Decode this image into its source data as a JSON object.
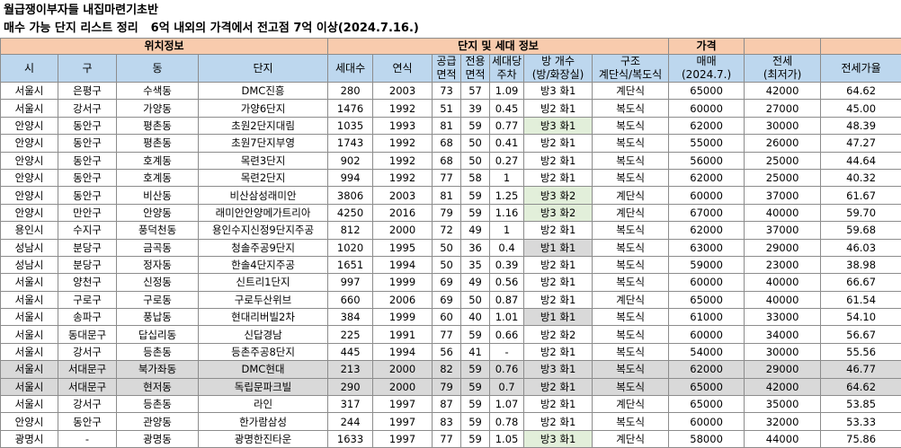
{
  "title_line1": "월급쟁이부자들 내집마련기초반",
  "title_line2_a": "매수 가능 단지 리스트 정리",
  "title_line2_b": "6억 내외의 가격에서 전고점 7억 이상(2024.7.16.)",
  "groups": {
    "location": "위치정보",
    "complex": "단지 및 세대 정보",
    "price": "가격"
  },
  "columns": [
    "시",
    "구",
    "동",
    "단지",
    "세대수",
    "연식",
    "공급\n면적",
    "전용\n면적",
    "세대당\n주차",
    "방 개수\n(방/화장실)",
    "구조\n계단식/복도식",
    "매매\n(2024.7.)",
    "전세\n(최저가)",
    "전세가율"
  ],
  "rows": [
    {
      "si": "서울시",
      "gu": "은평구",
      "dong": "수색동",
      "danji": "DMC진흥",
      "units": "280",
      "year": "2003",
      "supply": "73",
      "exclusive": "57",
      "parking": "1.09",
      "rooms": "방3 화1",
      "structure": "계단식",
      "sale": "65000",
      "jeonse": "42000",
      "ratio": "64.62",
      "room_hl": "",
      "row_hl": ""
    },
    {
      "si": "서울시",
      "gu": "강서구",
      "dong": "가양동",
      "danji": "가양6단지",
      "units": "1476",
      "year": "1992",
      "supply": "51",
      "exclusive": "39",
      "parking": "0.45",
      "rooms": "빙2 화1",
      "structure": "복도식",
      "sale": "60000",
      "jeonse": "27000",
      "ratio": "45.00",
      "room_hl": "",
      "row_hl": ""
    },
    {
      "si": "안양시",
      "gu": "동안구",
      "dong": "평촌동",
      "danji": "초원2단지대림",
      "units": "1035",
      "year": "1993",
      "supply": "81",
      "exclusive": "59",
      "parking": "0.77",
      "rooms": "방3 화1",
      "structure": "복도식",
      "sale": "62000",
      "jeonse": "30000",
      "ratio": "48.39",
      "room_hl": "green",
      "row_hl": ""
    },
    {
      "si": "안양시",
      "gu": "동안구",
      "dong": "평촌동",
      "danji": "초원7단지부영",
      "units": "1743",
      "year": "1992",
      "supply": "68",
      "exclusive": "50",
      "parking": "0.41",
      "rooms": "방2 화1",
      "structure": "복도식",
      "sale": "55000",
      "jeonse": "26000",
      "ratio": "47.27",
      "room_hl": "",
      "row_hl": ""
    },
    {
      "si": "안양시",
      "gu": "동안구",
      "dong": "호계동",
      "danji": "목련3단지",
      "units": "902",
      "year": "1992",
      "supply": "68",
      "exclusive": "50",
      "parking": "0.27",
      "rooms": "방2 화1",
      "structure": "복도식",
      "sale": "56000",
      "jeonse": "25000",
      "ratio": "44.64",
      "room_hl": "",
      "row_hl": ""
    },
    {
      "si": "안양시",
      "gu": "동안구",
      "dong": "호계동",
      "danji": "목련2단지",
      "units": "994",
      "year": "1992",
      "supply": "77",
      "exclusive": "58",
      "parking": "1",
      "rooms": "방2 화1",
      "structure": "복도식",
      "sale": "62000",
      "jeonse": "25000",
      "ratio": "40.32",
      "room_hl": "",
      "row_hl": ""
    },
    {
      "si": "안양시",
      "gu": "동안구",
      "dong": "비산동",
      "danji": "비산삼성래미안",
      "units": "3806",
      "year": "2003",
      "supply": "81",
      "exclusive": "59",
      "parking": "1.25",
      "rooms": "방3 화2",
      "structure": "계단식",
      "sale": "60000",
      "jeonse": "37000",
      "ratio": "61.67",
      "room_hl": "green",
      "row_hl": ""
    },
    {
      "si": "안양시",
      "gu": "만안구",
      "dong": "안양동",
      "danji": "래미안안양메가트리아",
      "units": "4250",
      "year": "2016",
      "supply": "79",
      "exclusive": "59",
      "parking": "1.16",
      "rooms": "방3 화2",
      "structure": "계단식",
      "sale": "67000",
      "jeonse": "40000",
      "ratio": "59.70",
      "room_hl": "green",
      "row_hl": ""
    },
    {
      "si": "용인시",
      "gu": "수지구",
      "dong": "풍덕천동",
      "danji": "용인수지신정9단지주공",
      "units": "812",
      "year": "2000",
      "supply": "72",
      "exclusive": "49",
      "parking": "1",
      "rooms": "방2 화1",
      "structure": "복도식",
      "sale": "62000",
      "jeonse": "37000",
      "ratio": "59.68",
      "room_hl": "",
      "row_hl": ""
    },
    {
      "si": "성남시",
      "gu": "분당구",
      "dong": "금곡동",
      "danji": "청솔주공9단지",
      "units": "1020",
      "year": "1995",
      "supply": "50",
      "exclusive": "36",
      "parking": "0.4",
      "rooms": "방1 화1",
      "structure": "복도식",
      "sale": "63000",
      "jeonse": "29000",
      "ratio": "46.03",
      "room_hl": "gray",
      "row_hl": ""
    },
    {
      "si": "성남시",
      "gu": "분당구",
      "dong": "정자동",
      "danji": "한솔4단지주공",
      "units": "1651",
      "year": "1994",
      "supply": "50",
      "exclusive": "35",
      "parking": "0.39",
      "rooms": "방2 화1",
      "structure": "복도식",
      "sale": "59000",
      "jeonse": "23000",
      "ratio": "38.98",
      "room_hl": "",
      "row_hl": ""
    },
    {
      "si": "서울시",
      "gu": "양천구",
      "dong": "신정동",
      "danji": "신트리1단지",
      "units": "997",
      "year": "1999",
      "supply": "69",
      "exclusive": "49",
      "parking": "0.56",
      "rooms": "방2 화1",
      "structure": "복도식",
      "sale": "60000",
      "jeonse": "40000",
      "ratio": "66.67",
      "room_hl": "",
      "row_hl": ""
    },
    {
      "si": "서울시",
      "gu": "구로구",
      "dong": "구로동",
      "danji": "구로두산위브",
      "units": "660",
      "year": "2006",
      "supply": "69",
      "exclusive": "50",
      "parking": "0.87",
      "rooms": "방2 화1",
      "structure": "계단식",
      "sale": "65000",
      "jeonse": "40000",
      "ratio": "61.54",
      "room_hl": "",
      "row_hl": ""
    },
    {
      "si": "서울시",
      "gu": "송파구",
      "dong": "풍납동",
      "danji": "현대리버빌2차",
      "units": "384",
      "year": "1999",
      "supply": "60",
      "exclusive": "40",
      "parking": "1.01",
      "rooms": "방1 화1",
      "structure": "복도식",
      "sale": "61000",
      "jeonse": "33000",
      "ratio": "54.10",
      "room_hl": "gray",
      "row_hl": ""
    },
    {
      "si": "서울시",
      "gu": "동대문구",
      "dong": "답십리동",
      "danji": "신답경남",
      "units": "225",
      "year": "1991",
      "supply": "77",
      "exclusive": "59",
      "parking": "0.66",
      "rooms": "방2 화2",
      "structure": "복도식",
      "sale": "60000",
      "jeonse": "34000",
      "ratio": "56.67",
      "room_hl": "",
      "row_hl": ""
    },
    {
      "si": "서울시",
      "gu": "강서구",
      "dong": "등촌동",
      "danji": "등촌주공8단지",
      "units": "445",
      "year": "1994",
      "supply": "56",
      "exclusive": "41",
      "parking": "-",
      "rooms": "방2 화1",
      "structure": "복도식",
      "sale": "54000",
      "jeonse": "30000",
      "ratio": "55.56",
      "room_hl": "",
      "row_hl": ""
    },
    {
      "si": "서울시",
      "gu": "서대문구",
      "dong": "북가좌동",
      "danji": "DMC현대",
      "units": "213",
      "year": "2000",
      "supply": "82",
      "exclusive": "59",
      "parking": "0.76",
      "rooms": "방3 화1",
      "structure": "복도식",
      "sale": "62000",
      "jeonse": "29000",
      "ratio": "46.77",
      "room_hl": "",
      "row_hl": "gray"
    },
    {
      "si": "서울시",
      "gu": "서대문구",
      "dong": "현저동",
      "danji": "독립문파크빌",
      "units": "290",
      "year": "2000",
      "supply": "79",
      "exclusive": "59",
      "parking": "0.7",
      "rooms": "방2 화1",
      "structure": "복도식",
      "sale": "65000",
      "jeonse": "42000",
      "ratio": "64.62",
      "room_hl": "",
      "row_hl": "gray"
    },
    {
      "si": "서울시",
      "gu": "강서구",
      "dong": "등촌동",
      "danji": "라인",
      "units": "317",
      "year": "1997",
      "supply": "87",
      "exclusive": "59",
      "parking": "1.07",
      "rooms": "방2 화1",
      "structure": "계단식",
      "sale": "65000",
      "jeonse": "35000",
      "ratio": "53.85",
      "room_hl": "",
      "row_hl": ""
    },
    {
      "si": "안양시",
      "gu": "동안구",
      "dong": "관양동",
      "danji": "한가람삼성",
      "units": "244",
      "year": "1997",
      "supply": "83",
      "exclusive": "59",
      "parking": "0.78",
      "rooms": "방2 화1",
      "structure": "복도식",
      "sale": "60000",
      "jeonse": "32000",
      "ratio": "53.33",
      "room_hl": "",
      "row_hl": ""
    },
    {
      "si": "광명시",
      "gu": "-",
      "dong": "광명동",
      "danji": "광명한진타운",
      "units": "1633",
      "year": "1997",
      "supply": "77",
      "exclusive": "59",
      "parking": "1.05",
      "rooms": "방3 화1",
      "structure": "계단식",
      "sale": "58000",
      "jeonse": "44000",
      "ratio": "75.86",
      "room_hl": "green",
      "row_hl": ""
    }
  ]
}
